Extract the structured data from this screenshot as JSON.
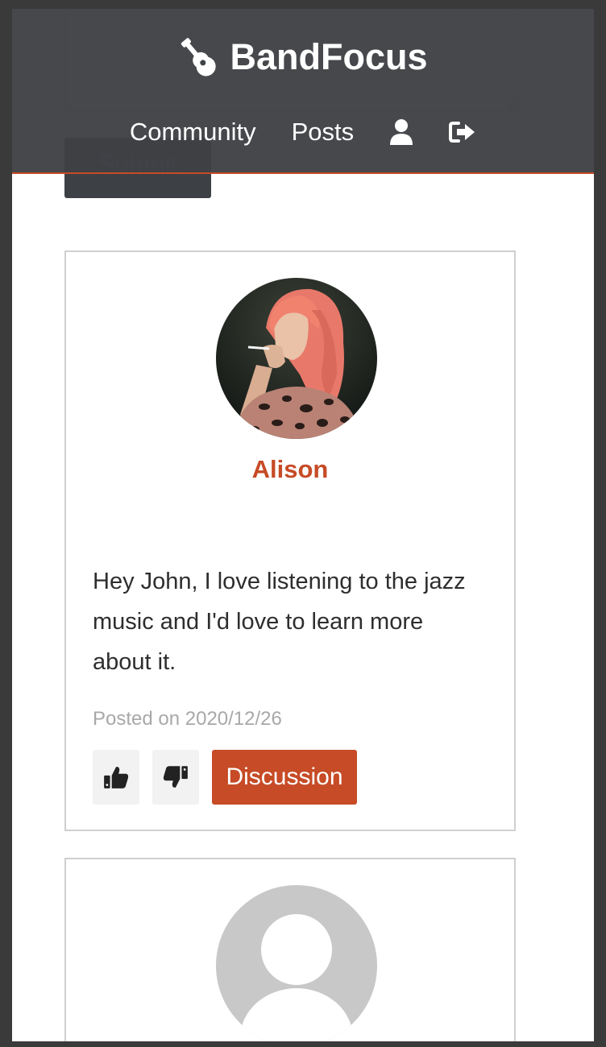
{
  "navbar": {
    "brand": "BandFocus",
    "brand_icon": "guitar-icon",
    "links": [
      "Community",
      "Posts"
    ],
    "profile_icon": "user-icon",
    "logout_icon": "sign-out-icon",
    "accent_color": "#c64b26"
  },
  "form": {
    "submit_label": "Submit"
  },
  "posts": [
    {
      "author": "Alison",
      "body": "Hey John, I love listening to the jazz music and I'd love to learn more about it.",
      "posted": "Posted on 2020/12/26",
      "like_icon": "thumbs-up-icon",
      "dislike_icon": "thumbs-down-icon",
      "discussion_label": "Discussion"
    },
    {
      "avatar_icon": "default-avatar-icon"
    }
  ]
}
